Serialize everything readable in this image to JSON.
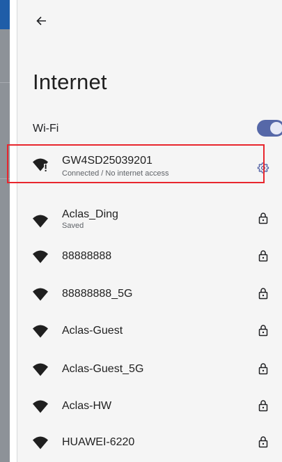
{
  "title": "Internet",
  "wifi": {
    "label": "Wi-Fi",
    "enabled": true
  },
  "colors": {
    "accent": "#5668a8",
    "highlight": "#e8262d"
  },
  "networks": [
    {
      "name": "GW4SD25039201",
      "status": "Connected / No internet access",
      "icon": "wifi-warning-icon",
      "trailing_icon": "gear-icon"
    },
    {
      "name": "Aclas_Ding",
      "status": "Saved",
      "icon": "wifi-icon",
      "trailing_icon": "lock-icon"
    },
    {
      "name": "88888888",
      "icon": "wifi-icon",
      "trailing_icon": "lock-icon"
    },
    {
      "name": "88888888_5G",
      "icon": "wifi-icon",
      "trailing_icon": "lock-icon"
    },
    {
      "name": "Aclas-Guest",
      "icon": "wifi-icon",
      "trailing_icon": "lock-icon"
    },
    {
      "name": "Aclas-Guest_5G",
      "icon": "wifi-icon",
      "trailing_icon": "lock-icon"
    },
    {
      "name": "Aclas-HW",
      "icon": "wifi-icon",
      "trailing_icon": "lock-icon"
    },
    {
      "name": "HUAWEI-6220",
      "icon": "wifi-icon",
      "trailing_icon": "lock-icon"
    }
  ]
}
